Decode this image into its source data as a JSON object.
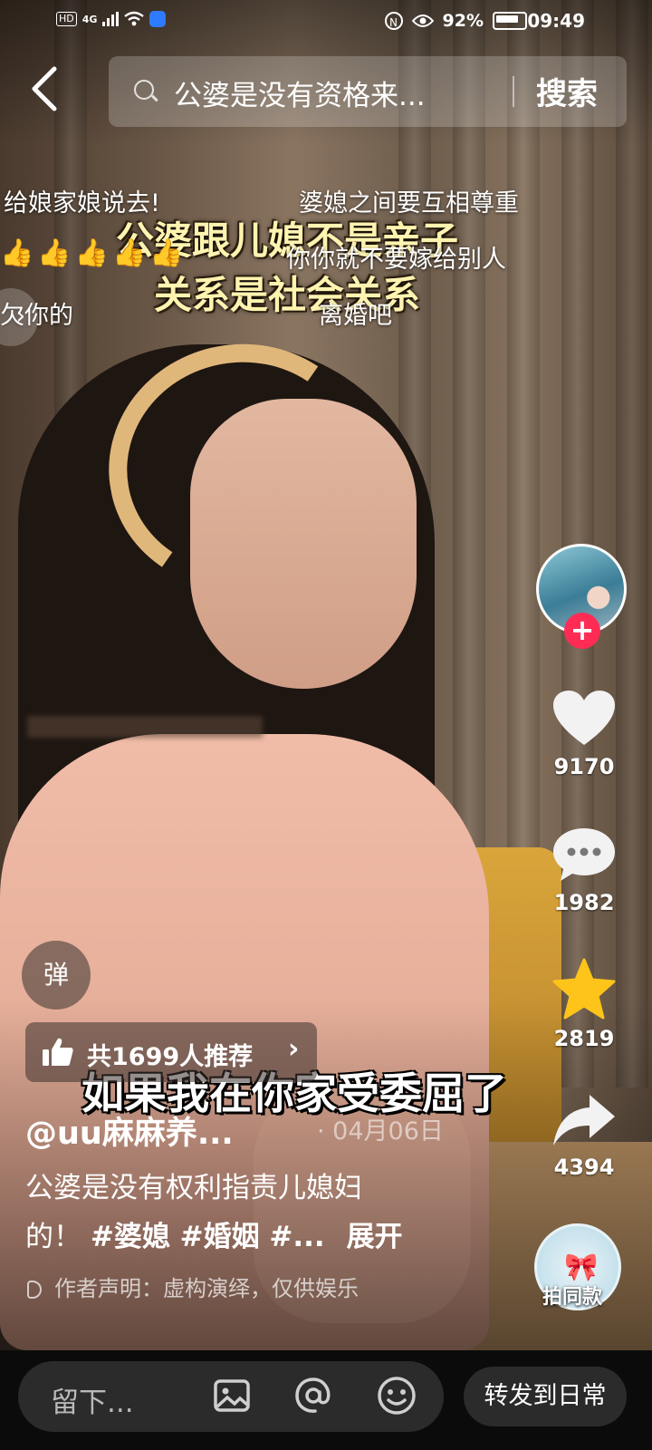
{
  "status_bar": {
    "hd": "HD",
    "network": "4G",
    "battery": "92%",
    "time": "09:49",
    "nfc": "N"
  },
  "search": {
    "query": "公婆是没有资格来...",
    "button": "搜索"
  },
  "danmaku": [
    "给娘家娘说去!",
    "婆媳之间要互相尊重",
    "你你就不要嫁给别人",
    "离婚吧",
    "欠你的"
  ],
  "thumbs": "👍👍👍👍👍",
  "caption_overlay": [
    "公婆跟儿媳不是亲子",
    "关系是社会关系"
  ],
  "subtitle": "如果我在你家受委屈了",
  "sidebar": {
    "likes": "9170",
    "comments": "1982",
    "favorites": "2819",
    "shares": "4394",
    "music_label": "拍同款"
  },
  "danmu_button": "弹",
  "recommend": {
    "text": "共1699人推荐",
    "chevron": "›"
  },
  "author": "@uu麻麻养...",
  "date": "04月06日",
  "description": {
    "line1": "公婆是没有权利指责儿媳妇",
    "line2_text": "的！",
    "tags": "#婆媳 #婚姻 #...",
    "expand": "展开"
  },
  "claim": "作者声明：虚构演绎，仅供娱乐",
  "bottom_bar": {
    "comment_placeholder": "留下...",
    "share_daily": "转发到日常"
  },
  "icons": [
    "back-icon",
    "search-icon",
    "heart-icon",
    "comment-icon",
    "star-icon",
    "share-icon",
    "image-icon",
    "at-icon",
    "emoji-icon",
    "thumbs-up-icon"
  ],
  "colors": {
    "follow": "#fe2c55",
    "star": "#ffc41a"
  }
}
